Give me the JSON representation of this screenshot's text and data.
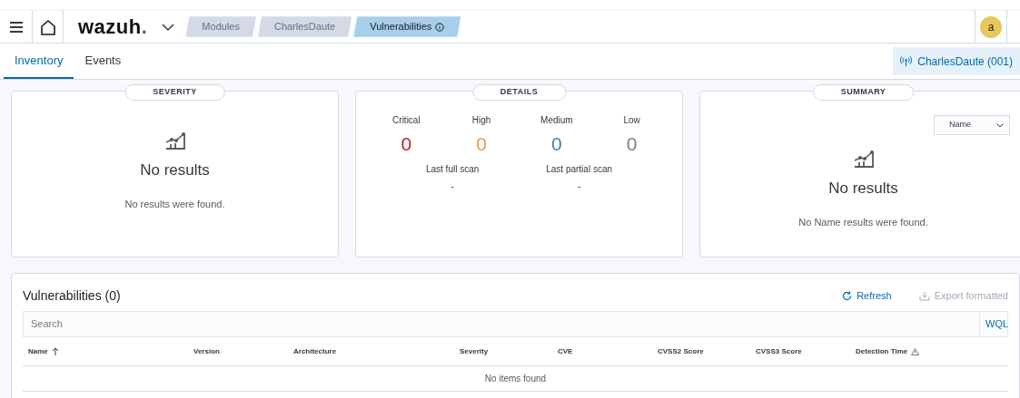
{
  "header": {
    "logo": "wazuh.",
    "breadcrumbs": [
      {
        "label": "Modules",
        "selected": false
      },
      {
        "label": "CharlesDaute",
        "selected": false
      },
      {
        "label": "Vulnerabilities",
        "selected": true
      }
    ],
    "avatar": "a"
  },
  "tabs": [
    {
      "label": "Inventory",
      "selected": true
    },
    {
      "label": "Events",
      "selected": false
    }
  ],
  "agent_button": "CharlesDaute (001)",
  "severity_panel": {
    "title": "SEVERITY",
    "empty_title": "No results",
    "empty_message": "No results were found."
  },
  "details_panel": {
    "title": "DETAILS",
    "counts": [
      {
        "label": "Critical",
        "value": "0",
        "color": "#bd271e"
      },
      {
        "label": "High",
        "value": "0",
        "color": "#d6a35c"
      },
      {
        "label": "Medium",
        "value": "0",
        "color": "#3a84c4"
      },
      {
        "label": "Low",
        "value": "0",
        "color": "#7a808c"
      }
    ],
    "scans": [
      {
        "label": "Last full scan",
        "value": "-"
      },
      {
        "label": "Last partial scan",
        "value": "-"
      }
    ]
  },
  "summary_panel": {
    "title": "SUMMARY",
    "select": "Name",
    "empty_title": "No results",
    "empty_message": "No Name results were found."
  },
  "table": {
    "title": "Vulnerabilities (0)",
    "actions": [
      {
        "label": "Refresh",
        "disabled": false
      },
      {
        "label": "Export formatted",
        "disabled": true
      }
    ],
    "search_placeholder": "Search",
    "query_button": "WQL",
    "columns": [
      {
        "label": "Name",
        "kind": "sorted"
      },
      {
        "label": "Version",
        "kind": "plain"
      },
      {
        "label": "Architecture",
        "kind": "plain"
      },
      {
        "label": "Severity",
        "kind": "plain"
      },
      {
        "label": "CVE",
        "kind": "plain"
      },
      {
        "label": "CVSS2 Score",
        "kind": "plain"
      },
      {
        "label": "CVSS3 Score",
        "kind": "plain"
      },
      {
        "label": "Detection Time",
        "kind": "warning"
      }
    ],
    "empty_message": "No items found"
  }
}
